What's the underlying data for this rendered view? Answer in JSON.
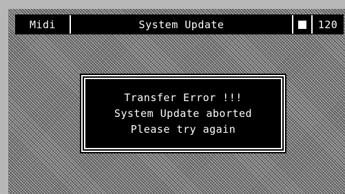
{
  "topbar": {
    "midi_label": "Midi",
    "title": "System Update",
    "status_square": "square-indicator-icon",
    "tempo": "120"
  },
  "dialog": {
    "line1": "Transfer Error !!!",
    "line2": "System Update aborted",
    "line3": "Please try again"
  },
  "colors": {
    "bar_background": "#000000",
    "text": "#ffffff",
    "screen_pattern": "#8c8c8c",
    "bezel": "#b8b8b8"
  }
}
